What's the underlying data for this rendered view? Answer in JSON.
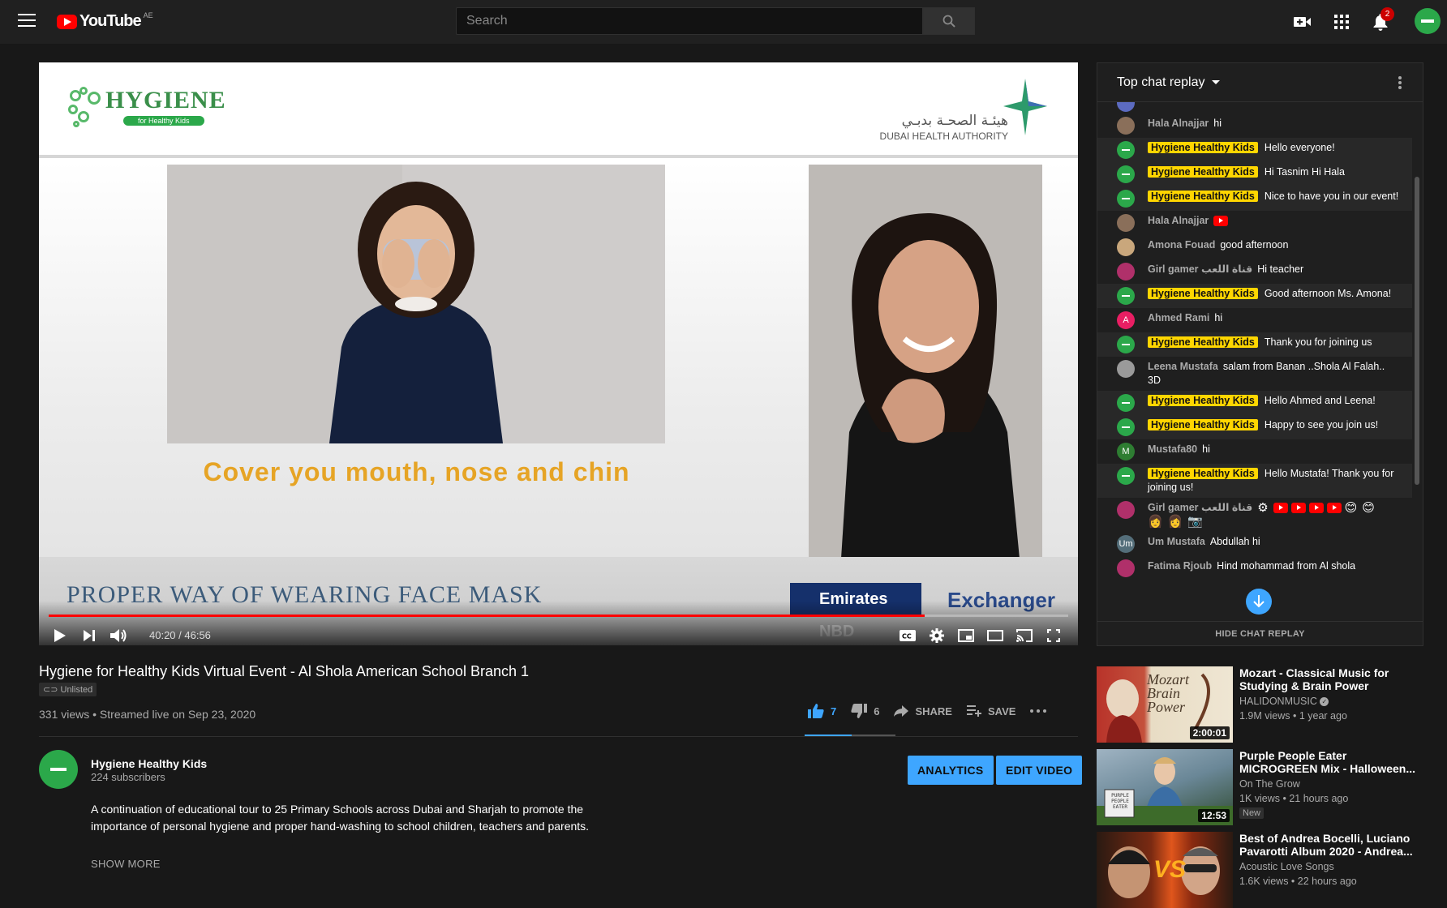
{
  "header": {
    "logo_text": "YouTube",
    "country_code": "AE",
    "search_placeholder": "Search",
    "notification_count": "2"
  },
  "video": {
    "slide_brand_title": "HYGIENE",
    "slide_brand_sub": "for Healthy Kids",
    "slide_authority_ar": "هيئـة الصحـة بدبـي",
    "slide_authority_en": "DUBAI HEALTH AUTHORITY",
    "slide_caption": "Cover you mouth, nose and chin",
    "slide_banner": "PROPER WAY OF WEARING FACE MASK",
    "sponsor_1": "Emirates NBD",
    "sponsor_2": "Exchanger",
    "time_display": "40:20 / 46:56",
    "progress_fraction": 0.859
  },
  "chat": {
    "header": "Top chat replay",
    "hide_label": "HIDE CHAT REPLAY",
    "messages": [
      {
        "author": "Hala Alnajjar",
        "text": "hi",
        "owner": false,
        "avatar": "img"
      },
      {
        "author": "Hygiene Healthy Kids",
        "text": "Hello everyone!",
        "owner": true,
        "avatar": "green"
      },
      {
        "author": "Hygiene Healthy Kids",
        "text": "Hi Tasnim Hi Hala",
        "owner": true,
        "avatar": "green"
      },
      {
        "author": "Hygiene Healthy Kids",
        "text": "Nice to have you in our event!",
        "owner": true,
        "avatar": "green"
      },
      {
        "author": "Hala Alnajjar",
        "text": "",
        "owner": false,
        "avatar": "img",
        "yt_emoji": true
      },
      {
        "author": "Amona Fouad",
        "text": "good afternoon",
        "owner": false,
        "avatar": "img2"
      },
      {
        "author": "Girl gamer قناة اللعب",
        "text": "Hi teacher",
        "owner": false,
        "avatar": "pink"
      },
      {
        "author": "Hygiene Healthy Kids",
        "text": "Good afternoon Ms. Amona!",
        "owner": true,
        "avatar": "green"
      },
      {
        "author": "Ahmed Rami",
        "text": "hi",
        "owner": false,
        "avatar": "A"
      },
      {
        "author": "Hygiene Healthy Kids",
        "text": "Thank you for joining us",
        "owner": true,
        "avatar": "green"
      },
      {
        "author": "Leena Mustafa",
        "text": "salam from Banan ..Shola Al Falah.. 3D",
        "owner": false,
        "avatar": "img3"
      },
      {
        "author": "Hygiene Healthy Kids",
        "text": "Hello Ahmed and Leena!",
        "owner": true,
        "avatar": "green"
      },
      {
        "author": "Hygiene Healthy Kids",
        "text": "Happy to see you join us!",
        "owner": true,
        "avatar": "green"
      },
      {
        "author": "Mustafa80",
        "text": "hi",
        "owner": false,
        "avatar": "M"
      },
      {
        "author": "Hygiene Healthy Kids",
        "text": "Hello Mustafa! Thank you for joining us!",
        "owner": true,
        "avatar": "green"
      },
      {
        "author": "Girl gamer قناة اللعب",
        "text": "",
        "owner": false,
        "avatar": "pink",
        "emoji_row": true
      },
      {
        "author": "Um Mustafa",
        "text": "Abdullah hi",
        "owner": false,
        "avatar": "Um"
      },
      {
        "author": "Fatima Rjoub",
        "text": "Hind mohammad from Al shola",
        "owner": false,
        "avatar": "pink"
      }
    ]
  },
  "info": {
    "title": "Hygiene for Healthy Kids Virtual Event - Al Shola American School Branch 1",
    "unlisted": "Unlisted",
    "meta": "331 views • Streamed live on Sep 23, 2020",
    "likes": "7",
    "dislikes": "6",
    "share": "SHARE",
    "save": "SAVE",
    "channel_name": "Hygiene Healthy Kids",
    "subscribers": "224 subscribers",
    "analytics": "ANALYTICS",
    "edit_video": "EDIT VIDEO",
    "description": "A continuation of educational tour to 25 Primary Schools across Dubai and Sharjah to promote the importance of personal hygiene and proper hand-washing to school children, teachers and parents.",
    "show_more": "SHOW MORE"
  },
  "recommendations": [
    {
      "title": "Mozart - Classical Music for Studying & Brain Power",
      "channel": "HALIDONMUSIC",
      "meta": "1.9M views • 1 year ago",
      "duration": "2:00:01",
      "verified": true,
      "thumb_text": "Mozart Brain Power"
    },
    {
      "title": "Purple People Eater MICROGREEN Mix - Halloween...",
      "channel": "On The Grow",
      "meta": "1K views • 21 hours ago",
      "duration": "12:53",
      "badge": "New",
      "thumb_text": "PURPLE PEOPLE EATER"
    },
    {
      "title": "Best of Andrea Bocelli, Luciano Pavarotti Album 2020 - Andrea...",
      "channel": "Acoustic Love Songs",
      "meta": "1.6K views • 22 hours ago",
      "thumb_text": "VS"
    }
  ]
}
